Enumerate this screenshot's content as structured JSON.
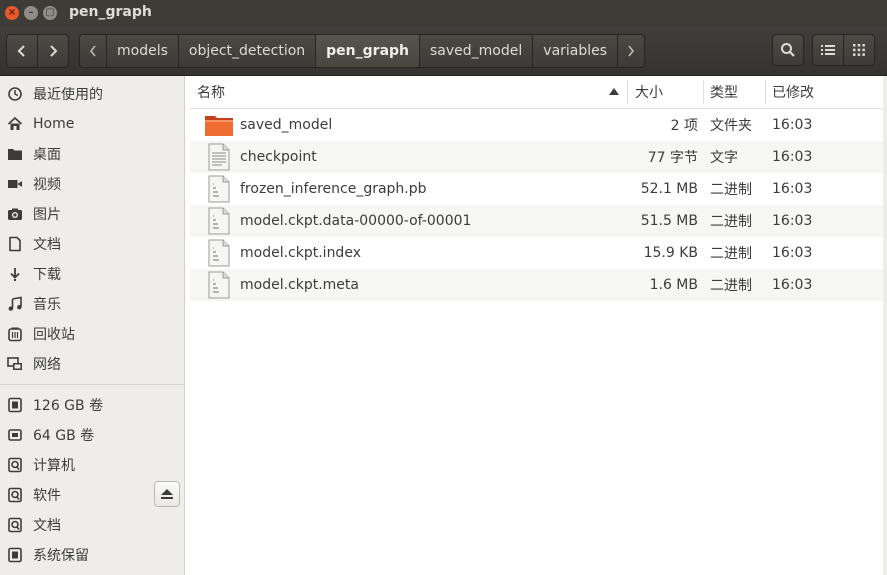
{
  "window": {
    "title": "pen_graph"
  },
  "toolbar": {
    "back_icon": "chevron-left-icon",
    "forward_icon": "chevron-right-icon",
    "crumbs": [
      "models",
      "object_detection",
      "pen_graph",
      "saved_model",
      "variables"
    ],
    "active_crumb": "pen_graph"
  },
  "sidebar": {
    "items": [
      {
        "label": "最近使用的",
        "icon": "clock-icon"
      },
      {
        "label": "Home",
        "icon": "home-icon"
      },
      {
        "label": "桌面",
        "icon": "folder-icon"
      },
      {
        "label": "视频",
        "icon": "video-icon"
      },
      {
        "label": "图片",
        "icon": "camera-icon"
      },
      {
        "label": "文档",
        "icon": "document-icon"
      },
      {
        "label": "下载",
        "icon": "download-icon"
      },
      {
        "label": "音乐",
        "icon": "music-icon"
      },
      {
        "label": "回收站",
        "icon": "trash-icon"
      },
      {
        "label": "网络",
        "icon": "network-icon"
      }
    ],
    "devices": [
      {
        "label": "126 GB 卷",
        "icon": "drive-icon"
      },
      {
        "label": "64 GB 卷",
        "icon": "usb-drive-icon"
      },
      {
        "label": "计算机",
        "icon": "computer-drive-icon"
      },
      {
        "label": "软件",
        "icon": "drive-icon"
      },
      {
        "label": "文档",
        "icon": "drive-icon"
      },
      {
        "label": "系统保留",
        "icon": "drive-icon"
      }
    ]
  },
  "list": {
    "columns": {
      "name": "名称",
      "size": "大小",
      "type": "类型",
      "modified": "已修改"
    },
    "rows": [
      {
        "name": "saved_model",
        "size": "2 项",
        "type": "文件夹",
        "modified": "16:03",
        "icon": "folder-icon"
      },
      {
        "name": "checkpoint",
        "size": "77 字节",
        "type": "文字",
        "modified": "16:03",
        "icon": "text-file-icon"
      },
      {
        "name": "frozen_inference_graph.pb",
        "size": "52.1 MB",
        "type": "二进制",
        "modified": "16:03",
        "icon": "binary-file-icon"
      },
      {
        "name": "model.ckpt.data-00000-of-00001",
        "size": "51.5 MB",
        "type": "二进制",
        "modified": "16:03",
        "icon": "binary-file-icon"
      },
      {
        "name": "model.ckpt.index",
        "size": "15.9 KB",
        "type": "二进制",
        "modified": "16:03",
        "icon": "binary-file-icon"
      },
      {
        "name": "model.ckpt.meta",
        "size": "1.6 MB",
        "type": "二进制",
        "modified": "16:03",
        "icon": "binary-file-icon"
      }
    ]
  }
}
